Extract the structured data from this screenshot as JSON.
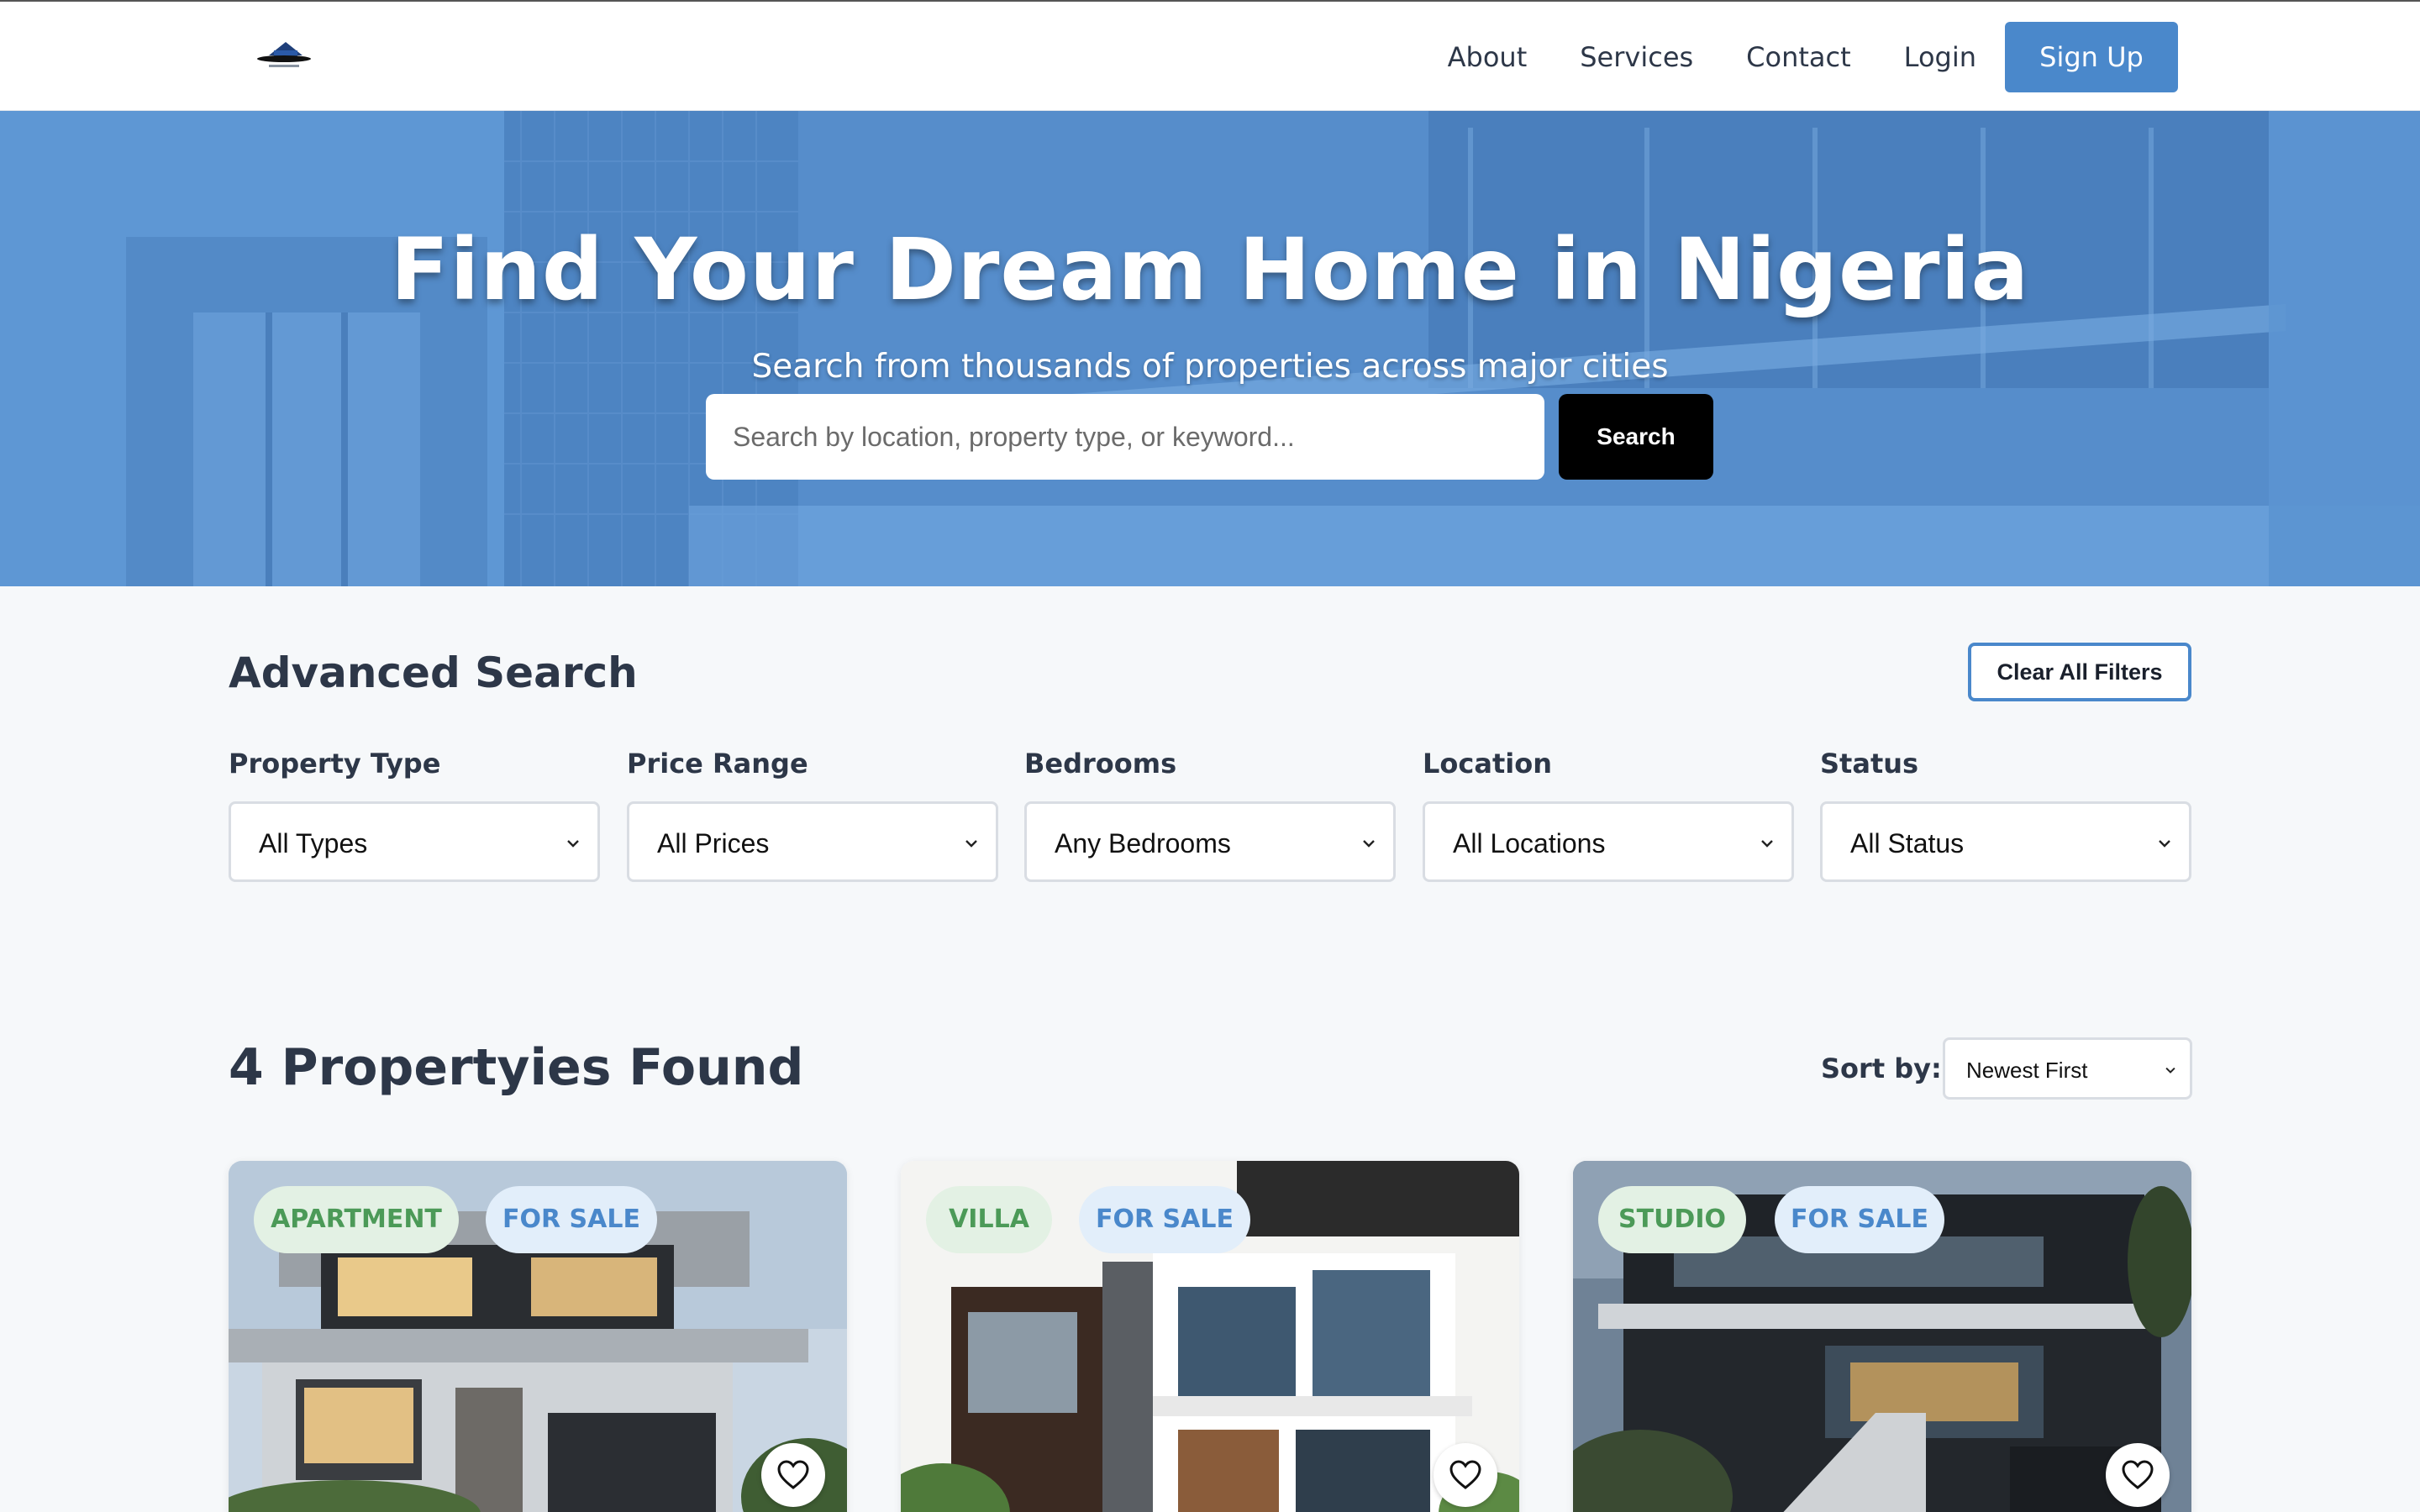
{
  "header": {
    "logo_alt": "Excellent Homes",
    "nav": [
      "About",
      "Services",
      "Contact",
      "Login"
    ],
    "signup_label": "Sign Up"
  },
  "hero": {
    "title": "Find Your Dream Home in Nigeria",
    "subtitle": "Search from thousands of properties across major cities",
    "search_placeholder": "Search by location, property type, or keyword...",
    "search_button": "Search"
  },
  "advanced_search": {
    "title": "Advanced Search",
    "clear_label": "Clear All Filters",
    "filters": [
      {
        "label": "Property Type",
        "value": "All Types"
      },
      {
        "label": "Price Range",
        "value": "All Prices"
      },
      {
        "label": "Bedrooms",
        "value": "Any Bedrooms"
      },
      {
        "label": "Location",
        "value": "All Locations"
      },
      {
        "label": "Status",
        "value": "All Status"
      }
    ]
  },
  "results": {
    "count_text": "4 Propertyies Found",
    "sort_label": "Sort by:",
    "sort_value": "Newest First",
    "cards": [
      {
        "type": "APARTMENT",
        "status": "FOR SALE"
      },
      {
        "type": "VILLA",
        "status": "FOR SALE"
      },
      {
        "type": "STUDIO",
        "status": "FOR SALE"
      }
    ]
  },
  "colors": {
    "accent": "#4a88cb",
    "type_badge_text": "#4c9a58",
    "type_badge_bg": "#e3f1e4",
    "status_badge_bg": "#e2eefa",
    "heading": "#2d3748"
  },
  "icons": [
    "house-logo-icon",
    "chevron-down-icon",
    "heart-icon"
  ]
}
